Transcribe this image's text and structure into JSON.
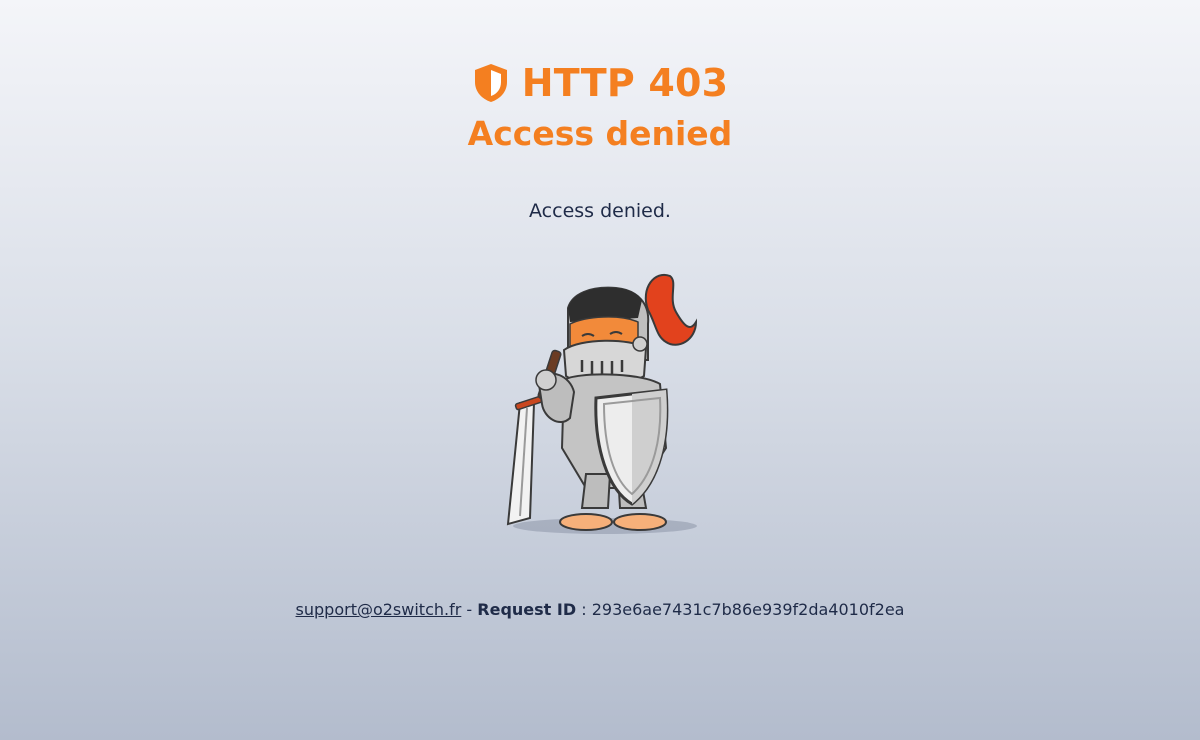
{
  "header": {
    "code": "HTTP 403",
    "title": "Access denied"
  },
  "message": "Access denied.",
  "footer": {
    "email": "support@o2switch.fr",
    "separator": "-",
    "request_id_label": "Request ID",
    "colon": ":",
    "request_id": "293e6ae7431c7b86e939f2da4010f2ea"
  },
  "colors": {
    "accent": "#f47f20",
    "text": "#1f2b48"
  },
  "icons": {
    "header": "shield-icon",
    "illustration": "knight-cat-mascot"
  }
}
